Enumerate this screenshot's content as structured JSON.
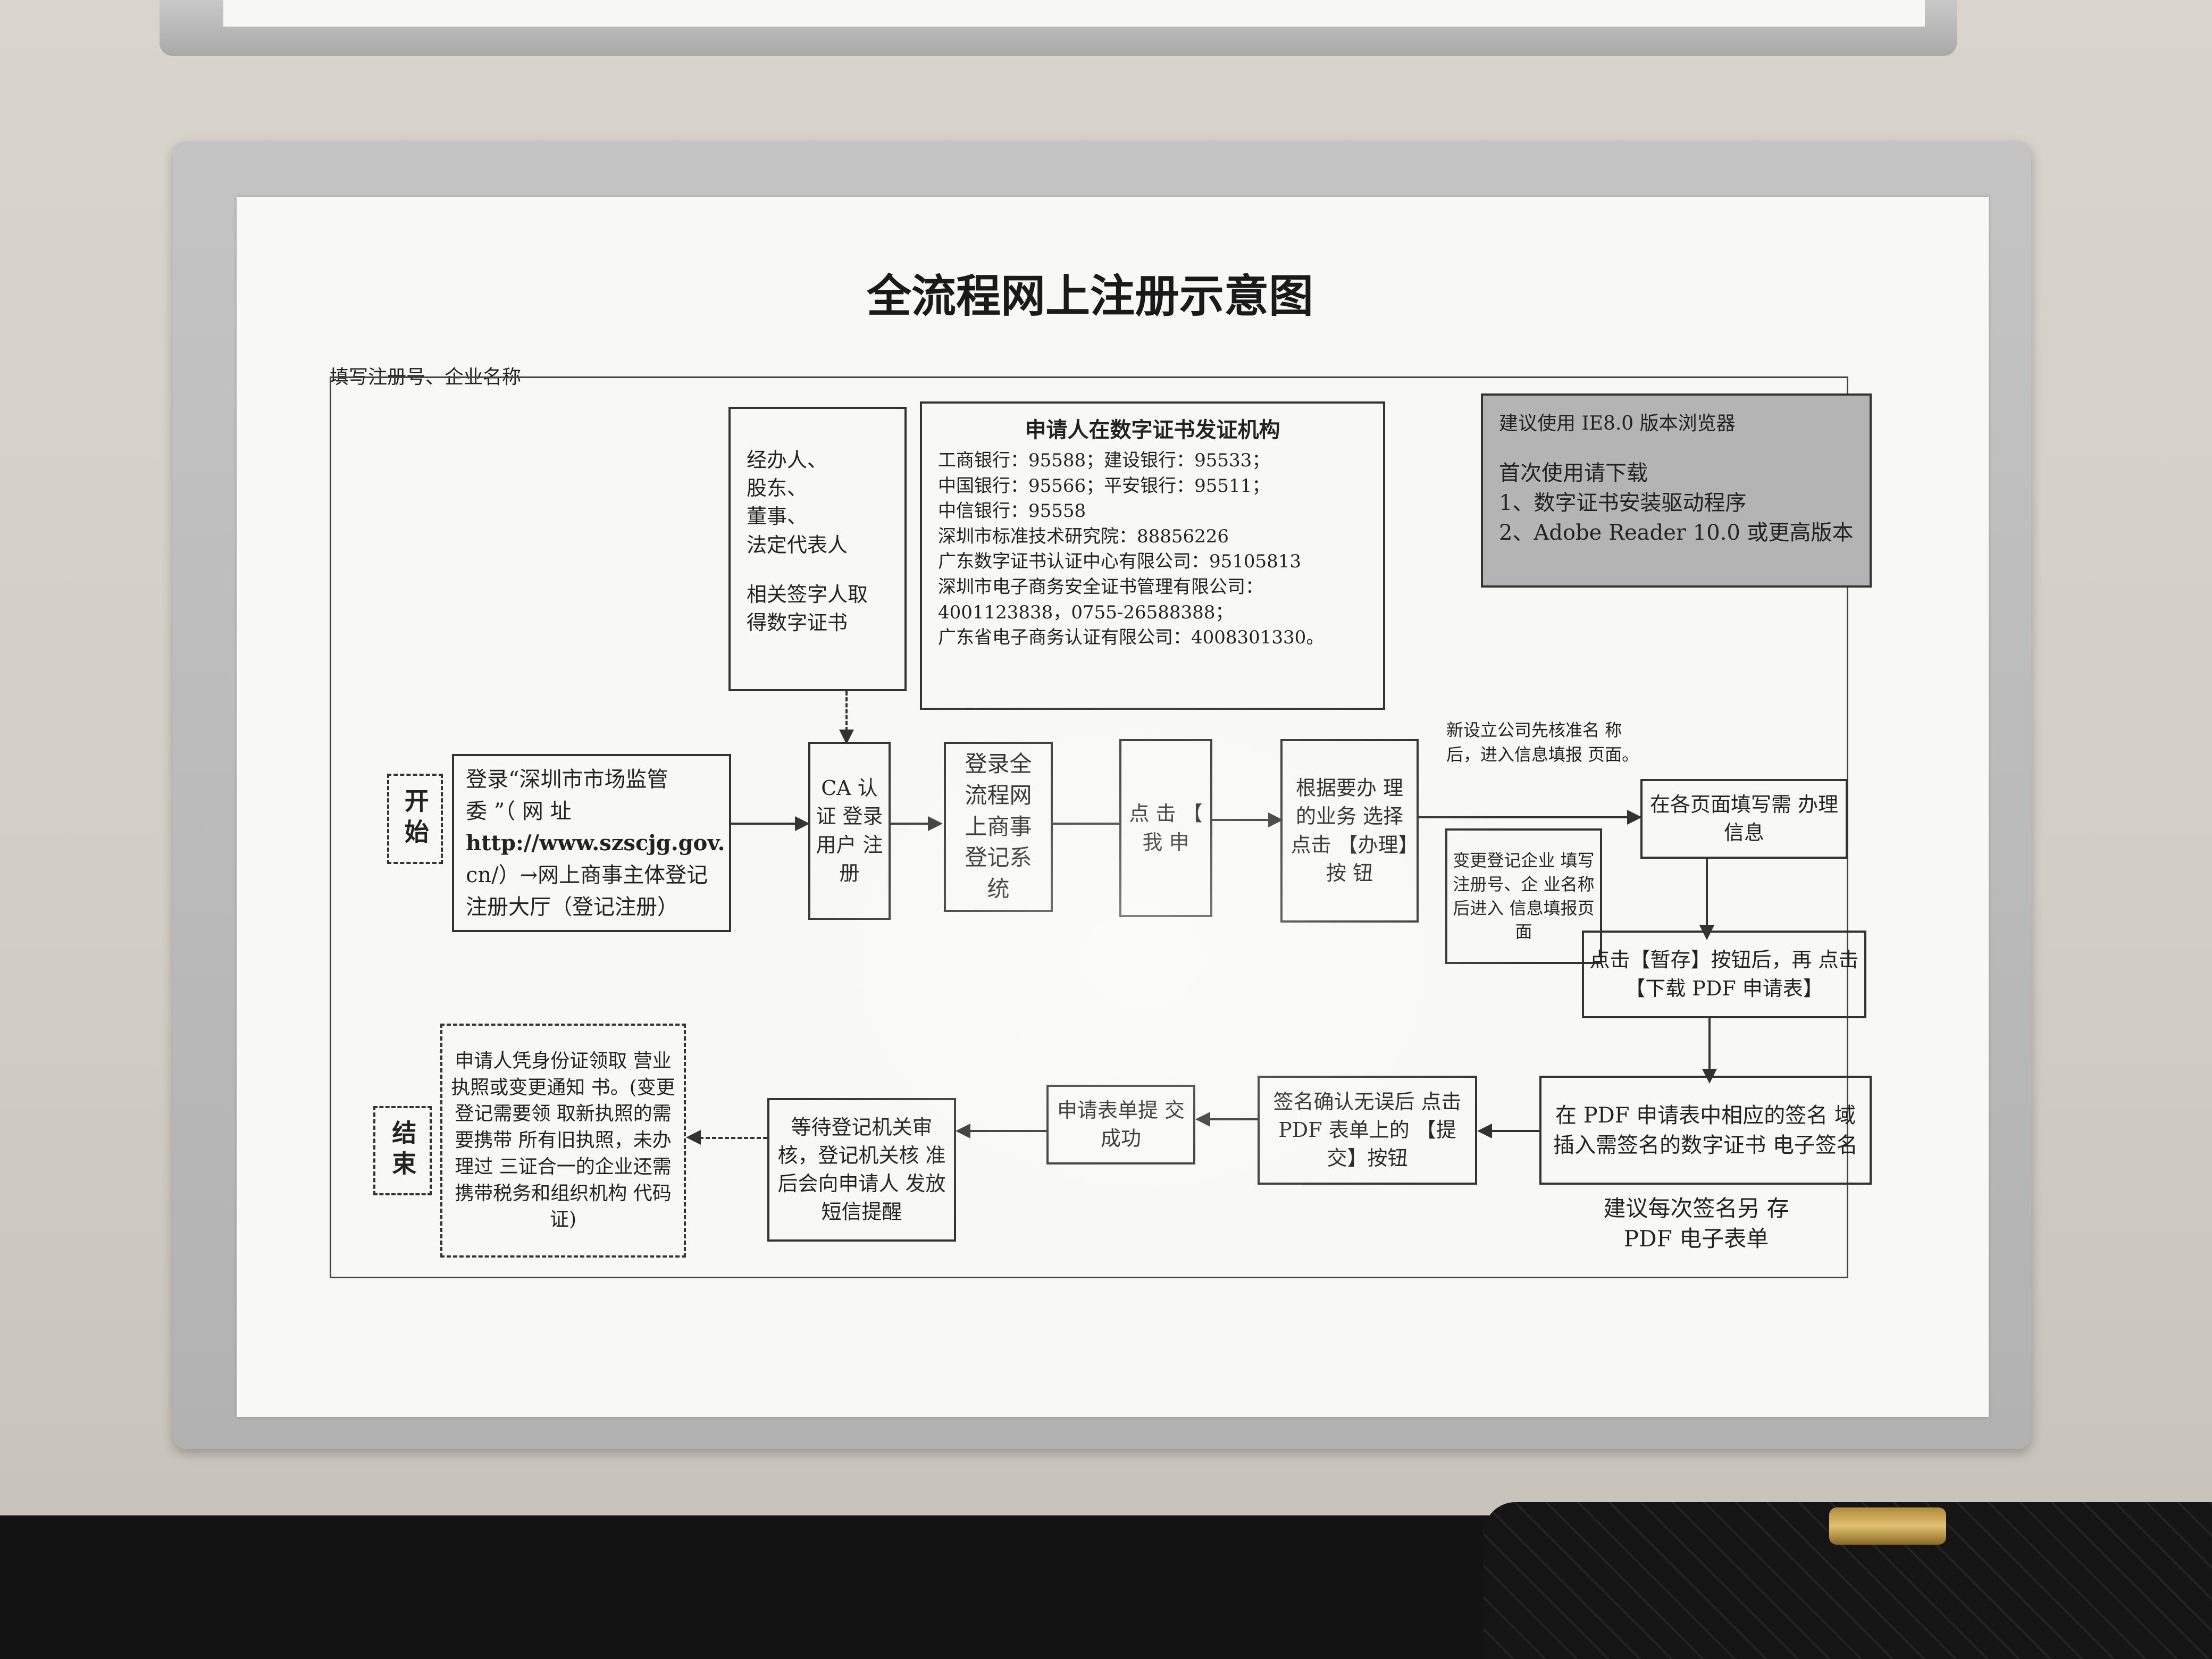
{
  "title": "全流程网上注册示意图",
  "top_note": "填写注册号、企业名称",
  "start_label": "开始",
  "end_label": "结束",
  "signers_box": {
    "lines": [
      "经办人、",
      "股东、",
      "董事、",
      "法定代表人",
      "",
      "相关签字人取",
      "得数字证书"
    ]
  },
  "ca_box": {
    "title": "申请人在数字证书发证机构",
    "lines": [
      "工商银行：95588；建设银行：95533；",
      "中国银行：95566；平安银行：95511；",
      "中信银行：95558",
      "深圳市标准技术研究院：88856226",
      "广东数字证书认证中心有限公司：95105813",
      "深圳市电子商务安全证书管理有限公司：",
      "4001123838，0755-26588388；",
      "广东省电子商务认证有限公司：4008301330。"
    ]
  },
  "browser_box": {
    "line1": "建议使用 IE8.0 版本浏览器",
    "line2": "首次使用请下载",
    "line3": "1、数字证书安装驱动程序",
    "line4": "2、Adobe Reader 10.0 或更高版本"
  },
  "steps": {
    "login": {
      "line1": "登录“深圳市市场监管",
      "line2": "委 ”（ 网 址",
      "line3": "http://www.szscjg.gov.",
      "line4": "cn/）→网上商事主体登记",
      "line5": "注册大厅（登记注册）"
    },
    "ca_login": "CA 认证 登录 用户 注册",
    "system_login": "登录全 流程网 上商事 登记系 统",
    "click_apply": "点 击 【 我 申",
    "choose_business": "根据要办 理的业务 选择点击 【办理】按 钮",
    "new_company_note": "新设立公司先核准名 称后，进入信息填报 页面。",
    "change_note": "变更登记企业 填写注册号、企 业名称后进入 信息填报页面",
    "fill_pages": "在各页面填写需 办理信息",
    "save_download": "点击【暂存】按钮后，再 点击【下载 PDF 申请表】",
    "sign_insert": "在 PDF 申请表中相应的签名 域插入需签名的数字证书 电子签名",
    "sign_note": "建议每次签名另 存 PDF 电子表单",
    "confirm_submit": "签名确认无误后 点击 PDF 表单上的 【提交】按钮",
    "submit_success": "申请表单提 交成功",
    "wait_review": "等待登记机关审 核，登记机关核 准后会向申请人 发放短信提醒",
    "collect_license": "申请人凭身份证领取 营业执照或变更通知 书。(变更登记需要领 取新执照的需要携带 所有旧执照，未办理过 三证合一的企业还需 携带税务和组织机构 代码证)"
  }
}
